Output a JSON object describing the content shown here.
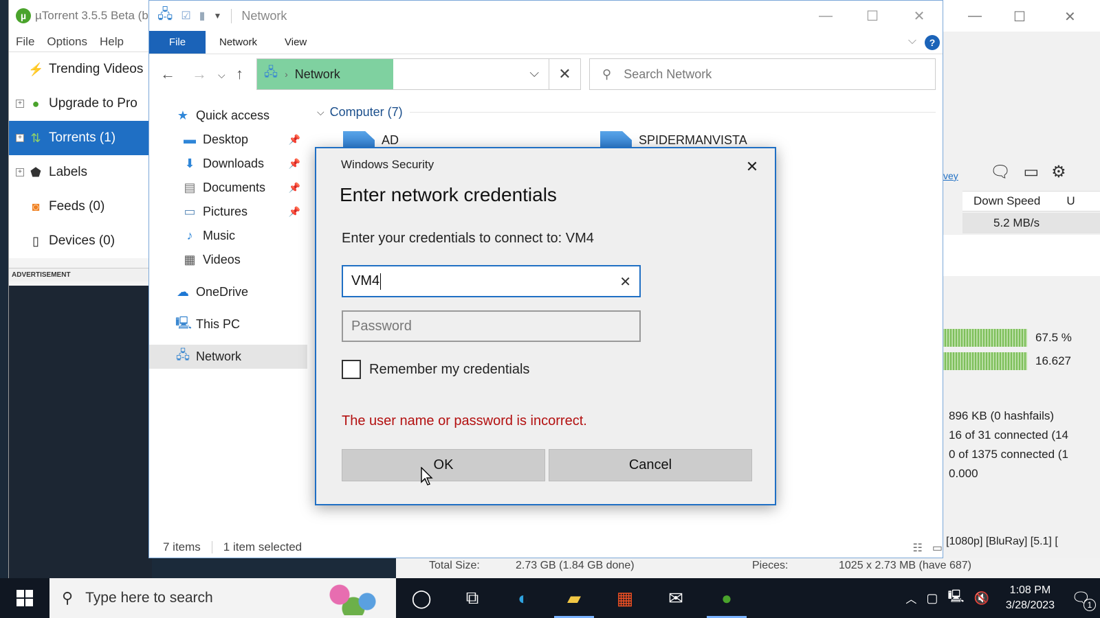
{
  "utorrent": {
    "title": "µTorrent 3.5.5 Beta (b",
    "menu": [
      "File",
      "Options",
      "Help"
    ],
    "sidebar": [
      {
        "label": "Trending Videos",
        "icon": "bolt-icon"
      },
      {
        "label": "Upgrade to Pro",
        "icon": "utorrent-logo-icon"
      },
      {
        "label": "Torrents (1)",
        "icon": "torrents-icon"
      },
      {
        "label": "Labels",
        "icon": "tag-icon"
      },
      {
        "label": "Feeds (0)",
        "icon": "rss-icon"
      },
      {
        "label": "Devices (0)",
        "icon": "device-icon"
      }
    ],
    "advertisement": "ADVERTISEMENT",
    "right_panel": {
      "link": "vey",
      "column_header": "Down Speed",
      "column_header_2": "U",
      "down_speed": "5.2 MB/s",
      "bar1_value": "67.5 %",
      "bar2_value": "16.627",
      "info": [
        "896 KB (0 hashfails)",
        "16 of 31 connected (14",
        "0 of 1375 connected (1",
        "0.000"
      ],
      "torrent_name": "[1080p] [BluRay] [5.1] ["
    },
    "details_bleed": {
      "total_size_label": "Total Size:",
      "total_size_value": "2.73 GB (1.84 GB done)",
      "pieces_label": "Pieces:",
      "pieces_value": "1025 x 2.73 MB (have 687)"
    }
  },
  "explorer": {
    "window_title": "Network",
    "ribbon_tabs": [
      "File",
      "Network",
      "View"
    ],
    "address_crumb": "Network",
    "search_placeholder": "Search Network",
    "nav": {
      "quick_access": "Quick access",
      "pinned": [
        {
          "label": "Desktop",
          "pinned": true
        },
        {
          "label": "Downloads",
          "pinned": true
        },
        {
          "label": "Documents",
          "pinned": true
        },
        {
          "label": "Pictures",
          "pinned": true
        },
        {
          "label": "Music",
          "pinned": false
        },
        {
          "label": "Videos",
          "pinned": false
        }
      ],
      "onedrive": "OneDrive",
      "this_pc": "This PC",
      "network": "Network"
    },
    "group_header": "Computer (7)",
    "computers": [
      "AD",
      "SPIDERMANVISTA"
    ],
    "status_items": "7 items",
    "status_selected": "1 item selected"
  },
  "dialog": {
    "window_title": "Windows Security",
    "heading": "Enter network credentials",
    "prompt": "Enter your credentials to connect to: VM4",
    "username_value": "VM4",
    "password_placeholder": "Password",
    "remember_label": "Remember my credentials",
    "remember_checked": false,
    "error": "The user name or password is incorrect.",
    "ok_label": "OK",
    "cancel_label": "Cancel",
    "error_color": "#b31010",
    "accent_color": "#1f6fc4"
  },
  "taskbar": {
    "search_placeholder": "Type here to search",
    "time": "1:08 PM",
    "date": "3/28/2023",
    "notification_count": "1",
    "pinned_apps": [
      "cortana-icon",
      "task-view-icon",
      "edge-icon",
      "file-explorer-icon",
      "store-icon",
      "mail-icon",
      "utorrent-icon"
    ]
  }
}
